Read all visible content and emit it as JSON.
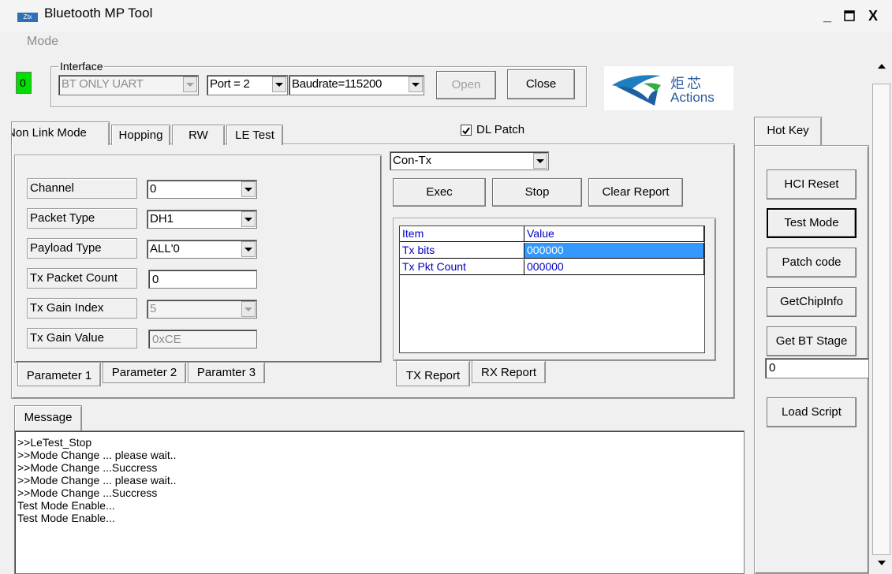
{
  "window": {
    "title": "Bluetooth MP Tool",
    "app_icon_label": "Ztx",
    "minimize": "_",
    "maximize": "□",
    "close": "X"
  },
  "menu": {
    "mode": "Mode"
  },
  "status_indicator": {
    "value": "0",
    "color": "#00e000"
  },
  "interface": {
    "label": "Interface",
    "interface_type": "BT ONLY UART",
    "port": "Port = 2",
    "baudrate": "Baudrate=115200",
    "open_label": "Open",
    "close_label": "Close"
  },
  "logo": {
    "chinese": "炬芯",
    "text": "Actions"
  },
  "main_tabs": [
    {
      "label": "Non Link Mode",
      "active": true
    },
    {
      "label": "Hopping"
    },
    {
      "label": "RW"
    },
    {
      "label": "LE Test"
    }
  ],
  "dl_patch": {
    "label": "DL Patch",
    "checked": true
  },
  "parameters": [
    {
      "label": "Channel",
      "value": "0",
      "kind": "combo"
    },
    {
      "label": "Packet Type",
      "value": "DH1",
      "kind": "combo"
    },
    {
      "label": "Payload Type",
      "value": "ALL'0",
      "kind": "combo"
    },
    {
      "label": "Tx Packet Count",
      "value": "0",
      "kind": "text"
    },
    {
      "label": "Tx Gain Index",
      "value": "5",
      "kind": "combo-disabled"
    },
    {
      "label": "Tx Gain Value",
      "value": "0xCE",
      "kind": "text-disabled"
    }
  ],
  "param_tabs": [
    {
      "label": "Parameter 1",
      "active": true
    },
    {
      "label": "Parameter 2"
    },
    {
      "label": "Paramter 3"
    }
  ],
  "test_mode_select": {
    "value": "Con-Tx"
  },
  "actions": {
    "exec": "Exec",
    "stop": "Stop",
    "clear_report": "Clear Report"
  },
  "report_table": {
    "headers": [
      "Item",
      "Value"
    ],
    "rows": [
      {
        "item": "Tx bits",
        "value": "000000",
        "selected": true
      },
      {
        "item": "Tx Pkt Count",
        "value": "000000"
      }
    ]
  },
  "report_tabs": [
    {
      "label": "TX Report",
      "active": true
    },
    {
      "label": "RX Report"
    }
  ],
  "message": {
    "tab_label": "Message",
    "lines": [
      ">>LeTest_Stop",
      ">>Mode Change ... please wait..",
      ">>Mode Change ...Succress",
      ">>Mode Change ... please wait..",
      ">>Mode Change ...Succress",
      "Test Mode Enable...",
      "Test Mode Enable..."
    ]
  },
  "hotkey": {
    "tab_label": "Hot Key",
    "hci_reset": "HCI Reset",
    "test_mode": "Test Mode",
    "patch_code": "Patch code",
    "get_chip_info": "GetChipInfo",
    "get_bt_stage": "Get BT Stage",
    "stage_value": "0",
    "load_script": "Load Script"
  }
}
